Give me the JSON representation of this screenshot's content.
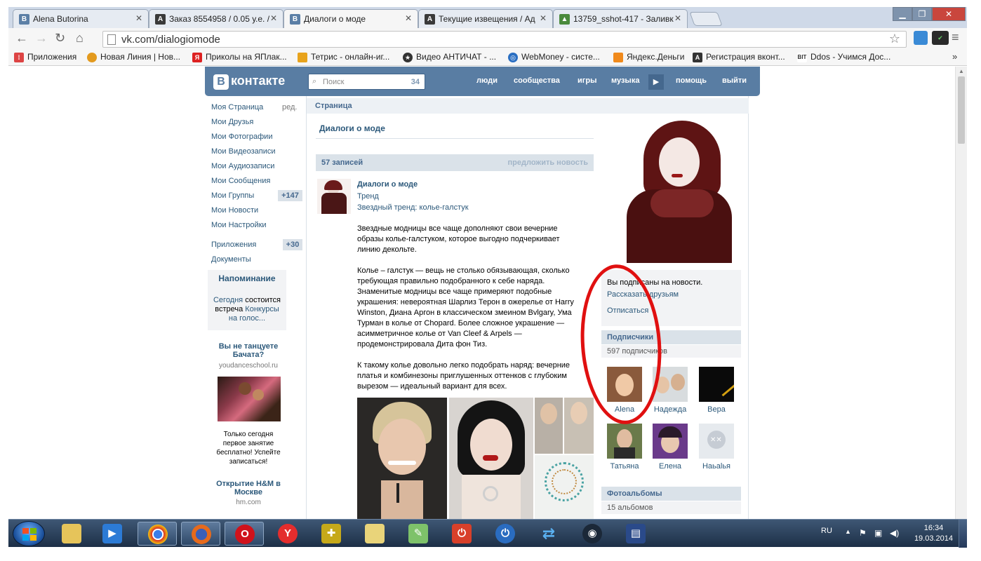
{
  "browser": {
    "tabs": [
      {
        "title": "Alena Butorina",
        "icon": "vk-icon",
        "color": "#5b7fa6"
      },
      {
        "title": "Заказ 8554958 / 0.05 у.е. /",
        "icon": "advego-icon",
        "color": "#3a3a3a"
      },
      {
        "title": "Диалоги о моде",
        "icon": "vk-icon",
        "color": "#5b7fa6"
      },
      {
        "title": "Текущие извещения / Ад",
        "icon": "advego-icon",
        "color": "#3a3a3a"
      },
      {
        "title": "13759_sshot-417 - Заливк",
        "icon": "image-icon",
        "color": "#4a8a3c"
      }
    ],
    "url": "vk.com/dialogiomode",
    "bookmarks": [
      {
        "label": "Приложения",
        "icon": "apps-grid-icon",
        "color": "#d44"
      },
      {
        "label": "Новая Линия | Нов...",
        "icon": "newline-icon",
        "color": "#e39a1e"
      },
      {
        "label": "Приколы на ЯПлак...",
        "icon": "yaplakal-icon",
        "color": "#d22"
      },
      {
        "label": "Тетрис - онлайн-иг...",
        "icon": "tetris-icon",
        "color": "#e8a31c"
      },
      {
        "label": "Видео АНТИЧАТ - ...",
        "icon": "antichat-icon",
        "color": "#333"
      },
      {
        "label": "WebMoney - систе...",
        "icon": "webmoney-icon",
        "color": "#2b6fc2"
      },
      {
        "label": "Яндекс.Деньги",
        "icon": "yandex-money-icon",
        "color": "#f08a1c"
      },
      {
        "label": "Регистрация вконт...",
        "icon": "advego-icon",
        "color": "#333"
      },
      {
        "label": "Ddos - Учимся Дос...",
        "icon": "bit-icon",
        "color": "#333"
      }
    ],
    "overflow_label": "»"
  },
  "vk": {
    "logo": "контакте",
    "logo_letter": "В",
    "search": {
      "placeholder": "Поиск",
      "count": "34"
    },
    "nav": [
      "люди",
      "сообщества",
      "игры",
      "музыка",
      "помощь",
      "выйти"
    ],
    "left_menu": [
      {
        "label": "Моя Страница",
        "extra": "ред."
      },
      {
        "label": "Мои Друзья"
      },
      {
        "label": "Мои Фотографии"
      },
      {
        "label": "Мои Видеозаписи"
      },
      {
        "label": "Мои Аудиозаписи"
      },
      {
        "label": "Мои Сообщения"
      },
      {
        "label": "Мои Группы",
        "count": "+147"
      },
      {
        "label": "Мои Новости"
      },
      {
        "label": "Мои Настройки"
      },
      {
        "label": "Приложения",
        "count": "+30"
      },
      {
        "label": "Документы"
      }
    ],
    "reminder": {
      "title": "Напоминание",
      "line1": "Сегодня",
      "line1b": "состоится",
      "line2": "встреча",
      "line2b": "Конкурсы",
      "line3": "на голос..."
    },
    "ads": [
      {
        "title1": "Вы не танцуете",
        "title2": "Бачата?",
        "domain": "youdanceschool.ru",
        "t1": "Только сегодня",
        "t2": "первое занятие",
        "t3": "бесплатно! Успейте",
        "t4": "записаться!"
      },
      {
        "title1": "Открытие H&M в",
        "title2": "Москве",
        "domain": "hm.com"
      }
    ],
    "page_bar": "Страница",
    "page_title": "Диалоги о моде",
    "wall": {
      "count": "57 записей",
      "suggest": "предложить новость"
    },
    "post": {
      "author": "Диалоги о моде",
      "tag": "Тренд",
      "subtitle": "Звездный тренд: колье-галстук",
      "p1": [
        "Звездные модницы все чаще дополняют свои вечерние",
        "образы колье-галстуком, которое выгодно подчеркивает",
        "линию декольте."
      ],
      "p2": [
        "Колье – галстук — вещь не столько обязывающая, сколько",
        "требующая правильно подобранного к себе наряда.",
        "Знаменитые модницы все чаще примеряют подобные",
        "украшения: невероятная Шарлиз Терон в ожерелье от Harry",
        "Winston, Диана Аргон в классическом змеином Bvlgary, Ума",
        "Турман в колье от Chopard. Более сложное украшение —",
        "асимметричное колье от Van Cleef & Arpels —",
        "продемонстрировала Дита фон Тиз."
      ],
      "p3": [
        "К такому колье довольно легко подобрать наряд: вечерние",
        "платья и комбинезоны приглушенных оттенков с глубоким",
        "вырезом — идеальный вариант для всех."
      ]
    },
    "subscription": {
      "status": "Вы подписаны на новости.",
      "tell": "Рассказать друзьям",
      "unsubscribe": "Отписаться"
    },
    "followers": {
      "title": "Подписчики",
      "count": "597 подписчиков",
      "people": [
        "Alena",
        "Надежда",
        "Вера",
        "Татьяна",
        "Елена",
        "Нaьаlья"
      ]
    },
    "albums": {
      "title": "Фотоальбомы",
      "count": "15 альбомов"
    }
  },
  "taskbar": {
    "apps": [
      "explorer-icon",
      "media-player-icon",
      "chrome-icon",
      "firefox-icon",
      "opera-icon",
      "yandex-browser-icon",
      "puzzle-icon",
      "image-viewer-icon",
      "notepad-icon",
      "power-off-icon",
      "power-icon",
      "sync-icon",
      "steam-icon",
      "save-icon"
    ],
    "lang": "RU",
    "time": "16:34",
    "date": "19.03.2014"
  }
}
